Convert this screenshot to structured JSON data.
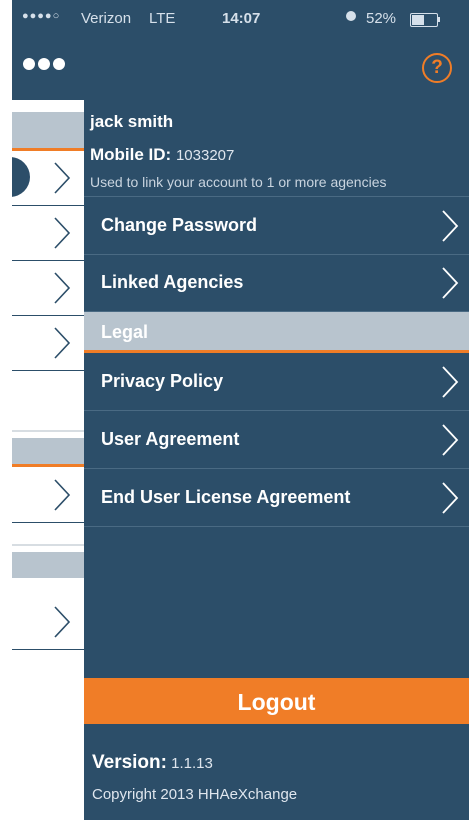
{
  "status_bar": {
    "signal": "●●●●○",
    "carrier": "Verizon",
    "network": "LTE",
    "time": "14:07",
    "alarm_icon": "alarm-clock-icon",
    "battery_percent": "52%",
    "battery_level": 0.52
  },
  "nav": {
    "menu_icon": "more-dots-icon",
    "help_label": "?"
  },
  "profile": {
    "name": "jack smith",
    "mobile_id_label": "Mobile ID:",
    "mobile_id_value": "1033207",
    "hint": "Used to link your account to 1 or more agencies"
  },
  "menu": {
    "account_items": [
      {
        "label": "Change Password"
      },
      {
        "label": "Linked Agencies"
      }
    ],
    "legal_section": "Legal",
    "legal_items": [
      {
        "label": "Privacy Policy"
      },
      {
        "label": "User Agreement"
      },
      {
        "label": "End User License Agreement"
      }
    ]
  },
  "logout_label": "Logout",
  "footer": {
    "version_label": "Version:",
    "version_value": "1.1.13",
    "copyright": "Copyright 2013 HHAeXchange"
  },
  "colors": {
    "navy": "#2c4e69",
    "orange": "#f07d27",
    "section_gray": "#b8c4ce"
  }
}
